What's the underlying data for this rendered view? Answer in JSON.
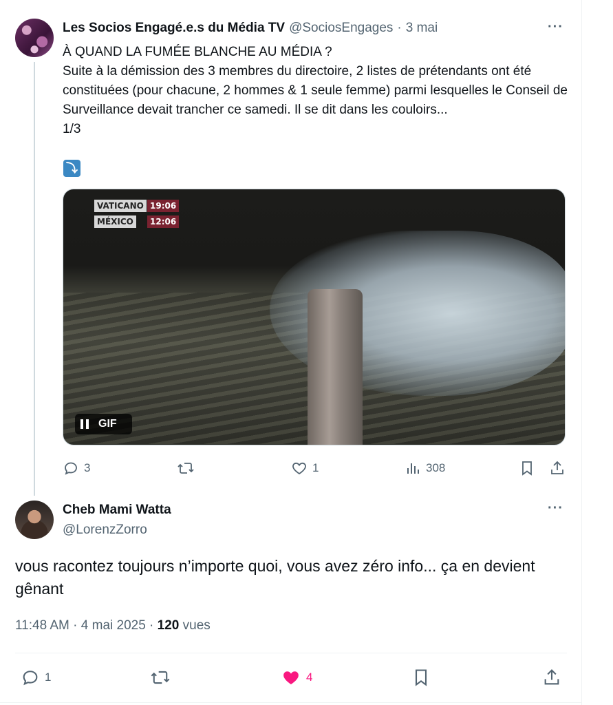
{
  "parent_tweet": {
    "author_name": "Les Socios Engagé.e.s du Média TV",
    "author_handle": "@SociosEngages",
    "separator": "·",
    "date": "3 mai",
    "more_icon": "more-dots-icon",
    "text": "À QUAND LA FUMÉE BLANCHE AU MÉDIA ?\nSuite à la démission des 3 membres du directoire, 2 listes de prétendants ont été constituées (pour chacune, 2 hommes & 1 seule femme) parmi lesquelles le Conseil de Surveillance devait trancher ce samedi. Il se dit dans les couloirs...\n1/3",
    "emoji": "⤵",
    "media": {
      "type": "GIF",
      "badge_label": "GIF",
      "overlay": [
        {
          "city": "VATICANO",
          "time": "19:06"
        },
        {
          "city": "MÉXICO",
          "time": "12:06"
        }
      ]
    },
    "actions": {
      "replies": "3",
      "retweets": "",
      "likes": "1",
      "views": "308"
    }
  },
  "reply_tweet": {
    "author_name": "Cheb Mami Watta",
    "author_handle": "@LorenzZorro",
    "more_icon": "more-dots-icon",
    "text": "vous racontez toujours n’importe quoi, vous avez zéro info... ça en devient gênant",
    "time": "11:48 AM",
    "sep1": " · ",
    "date": "4 mai 2025",
    "sep2": " · ",
    "views_count": "120",
    "views_label": " vues",
    "actions": {
      "replies": "1",
      "likes": "4",
      "liked": true
    }
  },
  "colors": {
    "text": "#0f1419",
    "secondary": "#536471",
    "like_pink": "#f91880",
    "border": "#eff3f4"
  }
}
